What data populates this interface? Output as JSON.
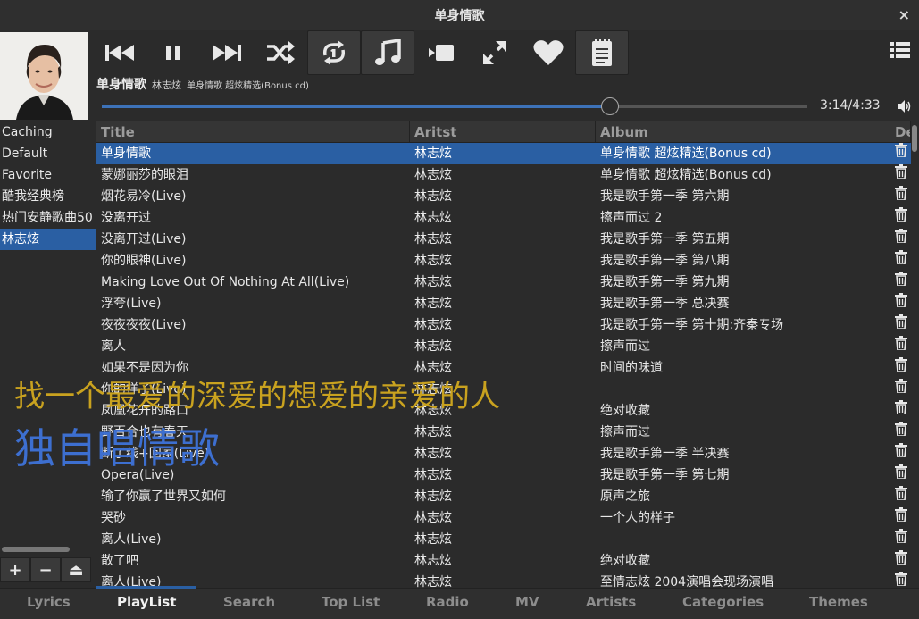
{
  "window": {
    "title": "单身情歌",
    "close": "×"
  },
  "now_playing": {
    "title": "单身情歌",
    "artist": "林志炫",
    "album": "单身情歌 超炫精选(Bonus cd)",
    "time": "3:14/4:33",
    "progress_fraction": 0.72
  },
  "toolbar": {
    "icons": [
      "previous-icon",
      "pause-icon",
      "next-icon",
      "shuffle-icon",
      "repeat-one-icon",
      "music-note-icon",
      "video-icon",
      "fullscreen-icon",
      "heart-icon",
      "playlist-doc-icon",
      "menu-icon"
    ]
  },
  "sidebar": {
    "items": [
      {
        "label": "Caching"
      },
      {
        "label": "Default"
      },
      {
        "label": "Favorite"
      },
      {
        "label": "酷我经典榜"
      },
      {
        "label": "热门安静歌曲50"
      },
      {
        "label": "林志炫",
        "selected": true
      }
    ],
    "add": "+",
    "remove": "−",
    "eject": "⏏"
  },
  "table": {
    "headers": {
      "title": "Title",
      "artist": "Aritst",
      "album": "Album",
      "del": "De"
    },
    "rows": [
      {
        "title": "单身情歌",
        "artist": "林志炫",
        "album": "单身情歌 超炫精选(Bonus cd)",
        "selected": true
      },
      {
        "title": "蒙娜丽莎的眼泪",
        "artist": "林志炫",
        "album": "单身情歌 超炫精选(Bonus cd)"
      },
      {
        "title": "烟花易冷(Live)",
        "artist": "林志炫",
        "album": "我是歌手第一季 第六期"
      },
      {
        "title": "没离开过",
        "artist": "林志炫",
        "album": "擦声而过 2"
      },
      {
        "title": "没离开过(Live)",
        "artist": "林志炫",
        "album": "我是歌手第一季 第五期"
      },
      {
        "title": "你的眼神(Live)",
        "artist": "林志炫",
        "album": "我是歌手第一季 第八期"
      },
      {
        "title": "Making Love Out Of Nothing At All(Live)",
        "artist": "林志炫",
        "album": "我是歌手第一季 第九期"
      },
      {
        "title": "浮夸(Live)",
        "artist": "林志炫",
        "album": "我是歌手第一季 总决赛"
      },
      {
        "title": "夜夜夜夜(Live)",
        "artist": "林志炫",
        "album": "我是歌手第一季 第十期:齐秦专场"
      },
      {
        "title": "离人",
        "artist": "林志炫",
        "album": "擦声而过"
      },
      {
        "title": "如果不是因为你",
        "artist": "林志炫",
        "album": "时间的味道"
      },
      {
        "title": "你的样子(Live)",
        "artist": "林志炫",
        "album": ""
      },
      {
        "title": "凤凰花开的路口",
        "artist": "林志炫",
        "album": "绝对收藏"
      },
      {
        "title": "野百合也有春天",
        "artist": "林志炫",
        "album": "擦声而过"
      },
      {
        "title": "断了线+回家(Live)",
        "artist": "林志炫",
        "album": "我是歌手第一季 半决赛"
      },
      {
        "title": "Opera(Live)",
        "artist": "林志炫",
        "album": "我是歌手第一季 第七期"
      },
      {
        "title": "输了你赢了世界又如何",
        "artist": "林志炫",
        "album": "原声之旅"
      },
      {
        "title": "哭砂",
        "artist": "林志炫",
        "album": "一个人的样子"
      },
      {
        "title": "离人(Live)",
        "artist": "林志炫",
        "album": ""
      },
      {
        "title": "散了吧",
        "artist": "林志炫",
        "album": "绝对收藏"
      },
      {
        "title": "离人(Live)",
        "artist": "林志炫",
        "album": "至情志炫 2004演唱会现场演唱"
      }
    ]
  },
  "lyrics": {
    "line1": "找一个最爱的深爱的想爱的亲爱的人",
    "line2": "独自唱情歌"
  },
  "tabs": [
    {
      "label": "Lyrics"
    },
    {
      "label": "PlayList",
      "active": true
    },
    {
      "label": "Search"
    },
    {
      "label": "Top List"
    },
    {
      "label": "Radio"
    },
    {
      "label": "MV"
    },
    {
      "label": "Artists"
    },
    {
      "label": "Categories"
    },
    {
      "label": "Themes"
    }
  ],
  "colors": {
    "accent": "#2a5fa3",
    "lyric_primary": "#c9a21f",
    "lyric_secondary": "#3d6fd0"
  }
}
